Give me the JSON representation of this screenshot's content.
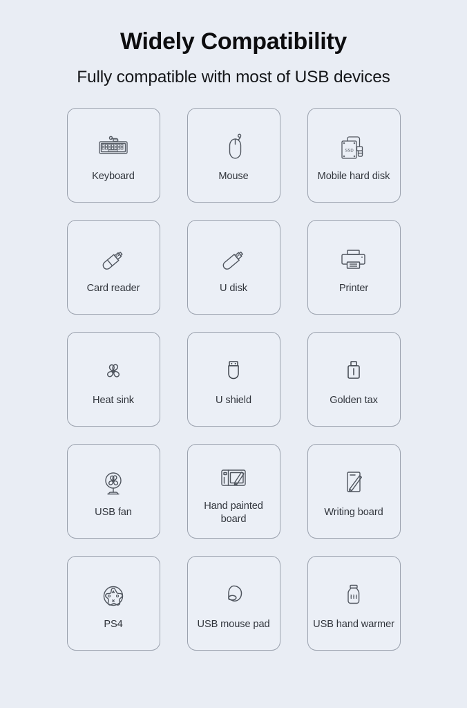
{
  "page": {
    "background_color": "#e9edf4",
    "card_background_color": "#ebeff6",
    "card_border_color": "#9aa1ad",
    "text_color": "#31353c",
    "title_color": "#0d0d0f"
  },
  "header": {
    "title": "Widely Compatibility",
    "subtitle": "Fully compatible with most of USB devices"
  },
  "grid": {
    "columns": 3,
    "rows": 5,
    "items": [
      {
        "label": "Keyboard",
        "icon": "keyboard-icon"
      },
      {
        "label": "Mouse",
        "icon": "mouse-icon"
      },
      {
        "label": "Mobile hard disk",
        "icon": "external-ssd-icon"
      },
      {
        "label": "Card reader",
        "icon": "card-reader-icon"
      },
      {
        "label": "U disk",
        "icon": "usb-flash-drive-icon"
      },
      {
        "label": "Printer",
        "icon": "printer-icon"
      },
      {
        "label": "Heat sink",
        "icon": "fan-blades-icon"
      },
      {
        "label": "U shield",
        "icon": "usb-token-icon"
      },
      {
        "label": "Golden tax",
        "icon": "usb-dongle-icon"
      },
      {
        "label": "USB fan",
        "icon": "desk-fan-icon"
      },
      {
        "label": "Hand painted board",
        "icon": "graphics-tablet-icon"
      },
      {
        "label": "Writing board",
        "icon": "writing-tablet-icon"
      },
      {
        "label": "PS4",
        "icon": "gamepad-icon"
      },
      {
        "label": "USB mouse pad",
        "icon": "mouse-pad-icon"
      },
      {
        "label": "USB hand warmer",
        "icon": "hand-warmer-icon"
      }
    ]
  }
}
